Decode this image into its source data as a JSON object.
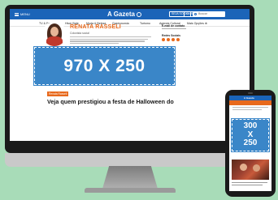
{
  "header": {
    "menu_label": "MENU",
    "logo_text": "A Gazeta",
    "buttons": [
      "SEJA SÓCIO",
      "SAIR"
    ],
    "search_placeholder": "Buscar"
  },
  "nav": {
    "items": [
      "TV & Famosos",
      "Hiver Bate",
      "Moda & Beleza",
      "Gastronomia",
      "Turismo",
      "Agenda Cultural",
      "Mais Opções ⊕"
    ]
  },
  "columnist": {
    "name": "RENATA RASSELI",
    "role": "Colunista social"
  },
  "contact": {
    "title": "E-mail de contato",
    "follow_title": "Redes Sociais"
  },
  "ad": {
    "desktop_label": "970 X 250",
    "mobile_lines": [
      "300",
      "X",
      "250"
    ]
  },
  "article": {
    "tag": "Renata Rasseli",
    "title": "Veja quem prestigiou a festa de Halloween do"
  },
  "colors": {
    "brand_blue": "#1b64b8",
    "accent_orange": "#e8691c",
    "ad_blue": "#3a86c8",
    "background_green": "#a8dcb8"
  }
}
